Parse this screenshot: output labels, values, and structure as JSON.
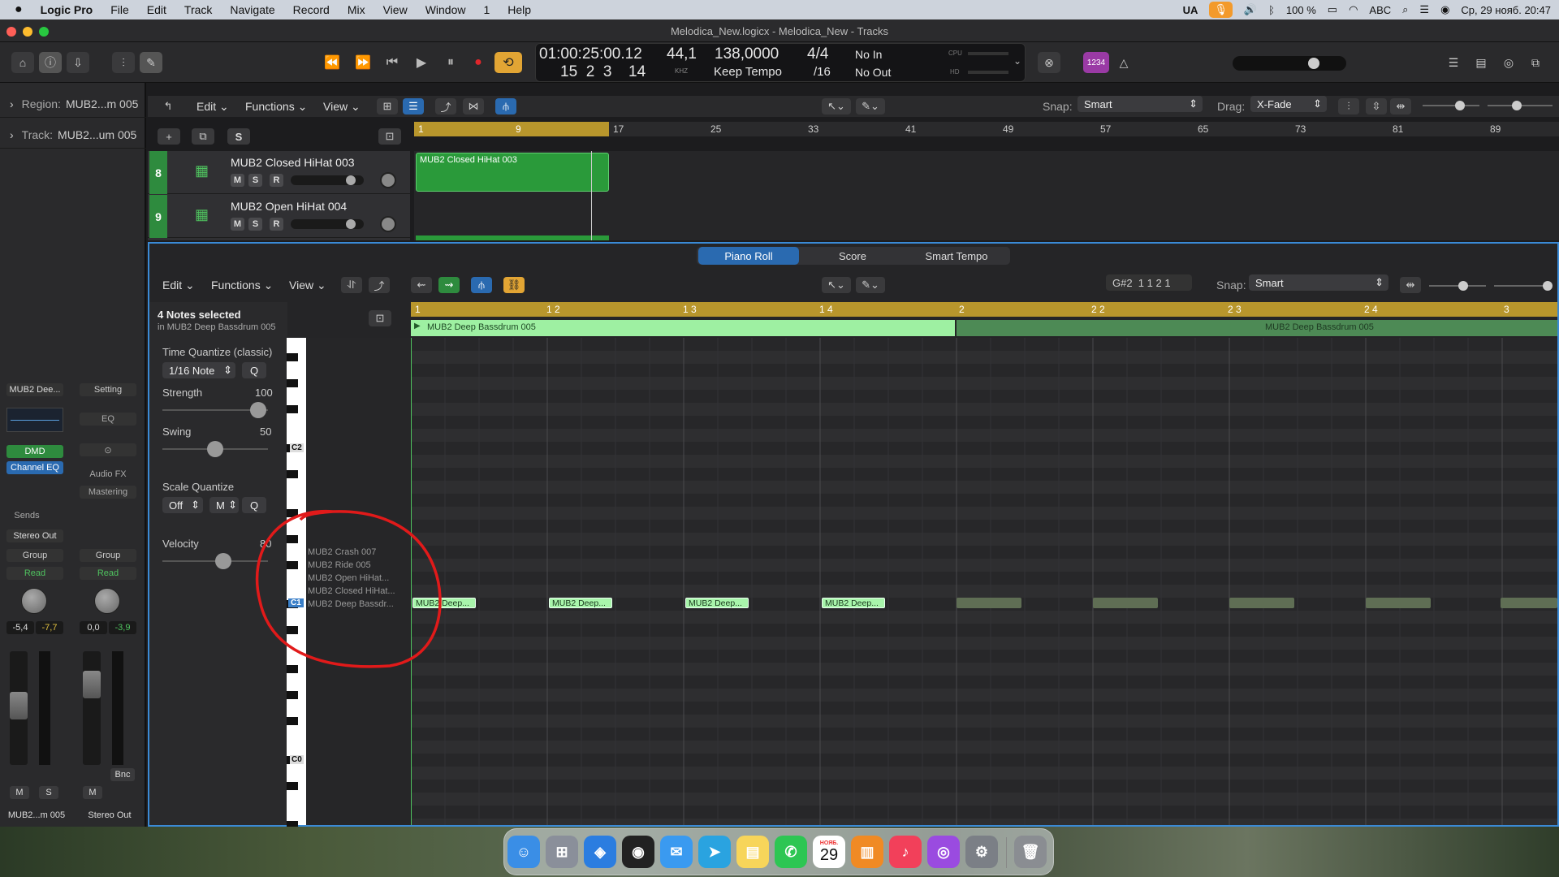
{
  "menubar": {
    "apple": "",
    "items": [
      "Logic Pro",
      "File",
      "Edit",
      "Track",
      "Navigate",
      "Record",
      "Mix",
      "View",
      "Window",
      "1",
      "Help"
    ],
    "right": {
      "lang": "UA",
      "battery": "100 %",
      "abc": "ABC",
      "datetime": "Ср, 29 нояб.  20:47"
    }
  },
  "window": {
    "title": "Melodica_New.logicx - Melodica_New - Tracks"
  },
  "lcd": {
    "position": "01:00:25:00.12",
    "bars": "15  2  3",
    "ticks": "14",
    "rate": "44,1",
    "rate_unit": "KHZ",
    "tempo": "138,0000",
    "tempo_mode": "Keep Tempo",
    "timesig": "4/4",
    "division": "/16",
    "in": "No In",
    "out": "No Out",
    "cpu": "CPU",
    "hd": "HD"
  },
  "controlbar": {
    "badge": "1234"
  },
  "inspector": {
    "region_label": "Region:",
    "region_value": "MUB2...m 005",
    "track_label": "Track:",
    "track_value": "MUB2...um 005",
    "strip1": {
      "name": "MUB2 Dee...",
      "dmd": "DMD",
      "eq": "Channel EQ",
      "sends": "Sends",
      "out": "Stereo Out",
      "group": "Group",
      "read": "Read",
      "vol": "-5,4",
      "peak": "-7,7",
      "m": "M",
      "s": "S",
      "footer": "MUB2...m 005"
    },
    "strip2": {
      "setting": "Setting",
      "eq": "EQ",
      "audiofx": "Audio FX",
      "mastering": "Mastering",
      "group": "Group",
      "read": "Read",
      "vol": "0,0",
      "peak": "-3,9",
      "bnc": "Bnc",
      "m": "M",
      "footer": "Stereo Out"
    }
  },
  "tracks_toolbar": {
    "edit": "Edit",
    "functions": "Functions",
    "view": "View",
    "snap_label": "Snap:",
    "snap_value": "Smart",
    "drag_label": "Drag:",
    "drag_value": "X-Fade"
  },
  "track_list": {
    "s_button": "S",
    "tracks": [
      {
        "num": "8",
        "name": "MUB2 Closed HiHat 003",
        "m": "M",
        "s": "S",
        "r": "R"
      },
      {
        "num": "9",
        "name": "MUB2 Open HiHat 004",
        "m": "M",
        "s": "S",
        "r": "R"
      }
    ],
    "ruler": [
      "1",
      "9",
      "17",
      "25",
      "33",
      "41",
      "49",
      "57",
      "65",
      "73",
      "81",
      "89"
    ],
    "region_name": "MUB2 Closed HiHat 003"
  },
  "piano_roll": {
    "tabs": [
      "Piano Roll",
      "Score",
      "Smart Tempo"
    ],
    "active_tab": "Piano Roll",
    "edit": "Edit",
    "functions": "Functions",
    "view": "View",
    "pitch_pos": "G#2  1 1 2 1",
    "snap_label": "Snap:",
    "snap_value": "Smart",
    "selection": "4 Notes selected",
    "selection_sub": "in MUB2 Deep Bassdrum 005",
    "tq_label": "Time Quantize (classic)",
    "tq_value": "1/16 Note",
    "q": "Q",
    "strength_label": "Strength",
    "strength_value": "100",
    "swing_label": "Swing",
    "swing_value": "50",
    "scale_label": "Scale Quantize",
    "scale_off": "Off",
    "scale_m": "M",
    "velocity_label": "Velocity",
    "velocity_value": "80",
    "key_labels": [
      "C2",
      "C1",
      "C0"
    ],
    "lane_names": [
      "MUB2 Crash 007",
      "MUB2 Ride 005",
      "MUB2 Open HiHat...",
      "MUB2 Closed HiHat...",
      "MUB2 Deep Bassdr..."
    ],
    "ruler": [
      "1",
      "1 2",
      "1 3",
      "1 4",
      "2",
      "2 2",
      "2 3",
      "2 4",
      "3"
    ],
    "region_name": "MUB2 Deep Bassdrum 005",
    "region_name_2": "MUB2 Deep Bassdrum 005",
    "note_label": "MUB2 Deep..."
  },
  "dock": {
    "calendar_month": "НОЯБ.",
    "calendar_day": "29"
  }
}
